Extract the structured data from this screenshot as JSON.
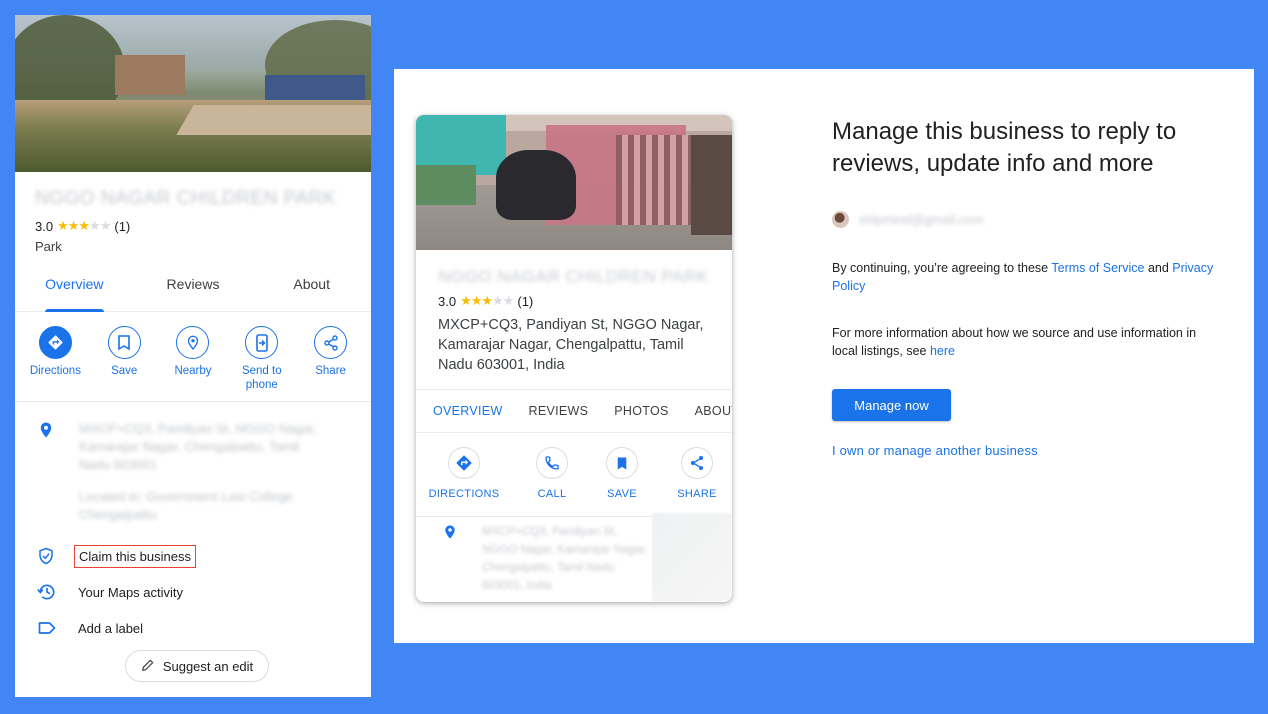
{
  "left_panel": {
    "place_name": "NGGO NAGAR CHILDREN PARK",
    "rating": "3.0",
    "review_count": "(1)",
    "stars_filled": 3,
    "category": "Park",
    "tabs": [
      "Overview",
      "Reviews",
      "About"
    ],
    "actions": [
      {
        "label": "Directions",
        "icon": "directions-icon"
      },
      {
        "label": "Save",
        "icon": "bookmark-icon"
      },
      {
        "label": "Nearby",
        "icon": "nearby-icon"
      },
      {
        "label": "Send to phone",
        "icon": "send-to-phone-icon"
      },
      {
        "label": "Share",
        "icon": "share-icon"
      }
    ],
    "address_blurred": "MXCP+CQ3, Pandiyan St, NGGO Nagar, Kamarajar Nagar, Chengalpattu, Tamil Nadu 603001",
    "located_in_blurred": "Located in: Government Law College Chengalpattu",
    "menu": [
      {
        "label": "Claim this business",
        "icon": "shield-check-icon"
      },
      {
        "label": "Your Maps activity",
        "icon": "history-icon"
      },
      {
        "label": "Add a label",
        "icon": "label-icon"
      }
    ],
    "suggest_edit": "Suggest an edit"
  },
  "card": {
    "place_name": "NGGO NAGAR CHILDREN PARK",
    "rating": "3.0",
    "review_count": "(1)",
    "address": "MXCP+CQ3, Pandiyan St, NGGO Nagar, Kamarajar Nagar, Chengalpattu, Tamil Nadu 603001, India",
    "tabs": [
      "OVERVIEW",
      "REVIEWS",
      "PHOTOS",
      "ABOUT"
    ],
    "actions": [
      {
        "label": "DIRECTIONS",
        "icon": "directions-icon"
      },
      {
        "label": "CALL",
        "icon": "phone-icon"
      },
      {
        "label": "SAVE",
        "icon": "bookmark-icon"
      },
      {
        "label": "SHARE",
        "icon": "share-icon"
      }
    ],
    "address_blurred": "MXCP+CQ3, Pandiyan St, NGGO Nagar, Kamarajar Nagar, Chengalpattu, Tamil Nadu 603001, India"
  },
  "manage": {
    "title": "Manage this business to reply to reviews, update info and more",
    "email_blurred": "shlpmind@gmail.com",
    "consent_prefix": "By continuing, you’re agreeing to these ",
    "terms_link": "Terms of Service",
    "and": " and ",
    "privacy_link": "Privacy Policy",
    "info_prefix": "For more information about how we source and use information in local listings, see ",
    "here_link": "here",
    "manage_button": "Manage now",
    "other_business_link": "I own or manage another business"
  },
  "colors": {
    "background": "#4285f4",
    "accent": "#1a73e8",
    "star": "#fbbc04",
    "claim_outline": "#ea4335"
  }
}
